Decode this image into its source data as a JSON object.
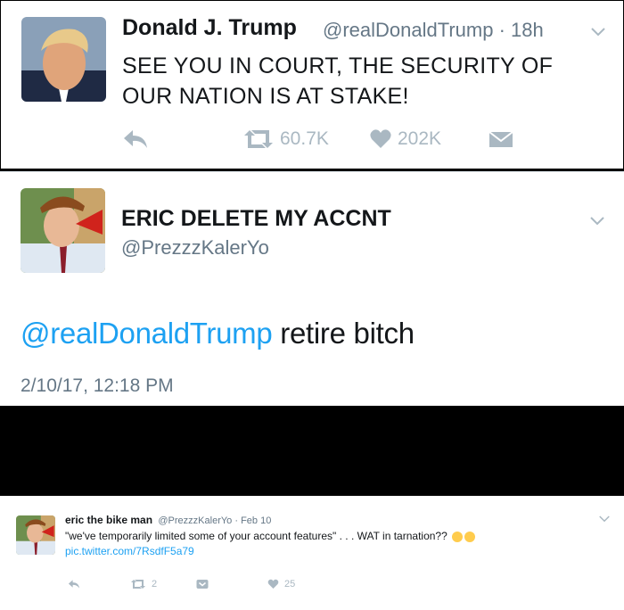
{
  "tweet1": {
    "name": "Donald J. Trump",
    "handle": "@realDonaldTrump · 18h",
    "text": "SEE YOU IN COURT, THE SECURITY OF OUR NATION IS AT STAKE!",
    "retweets": "60.7K",
    "likes": "202K"
  },
  "tweet2": {
    "name": "ERIC DELETE MY ACCNT",
    "handle": "@PrezzzKalerYo",
    "mention": "@realDonaldTrump",
    "text": " retire bitch",
    "date": "2/10/17, 12:18 PM"
  },
  "tweet3": {
    "name": "eric the bike man",
    "meta": "@PrezzzKalerYo · Feb 10",
    "text": "\"we've temporarily limited some of your account features\" . . . WAT in tarnation??",
    "link": "pic.twitter.com/7RsdfF5a79",
    "retweets": "2",
    "likes": "25"
  },
  "colors": {
    "accent": "#1da1f2",
    "muted": "#657786",
    "icon": "#aab8c2"
  },
  "icons": [
    "reply-icon",
    "retweet-icon",
    "like-icon",
    "dm-icon",
    "chevron-down-icon",
    "angry-emoji-icon"
  ]
}
